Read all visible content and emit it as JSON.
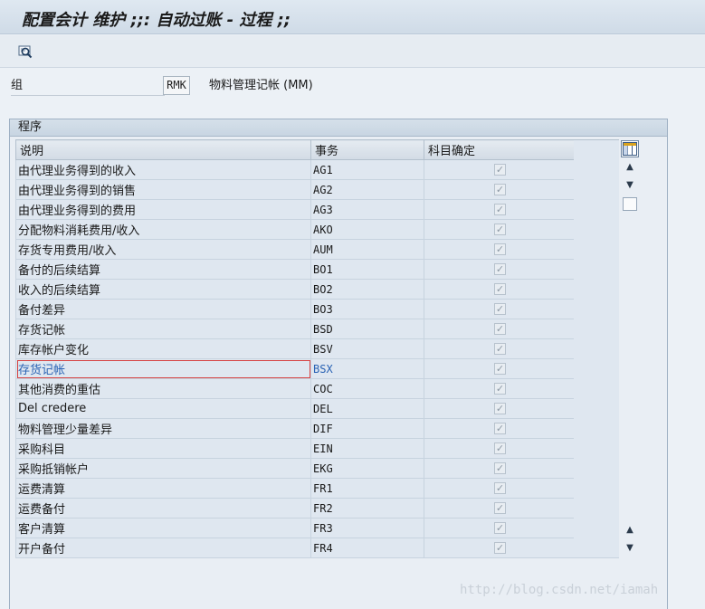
{
  "title": "配置会计 维护 ;;: 自动过账 - 过程 ;;",
  "toolbar": {
    "icon": "find-icon"
  },
  "header_field": {
    "label": "组",
    "value": "RMK",
    "description": "物料管理记帐 (MM)"
  },
  "group": {
    "title": "程序"
  },
  "table": {
    "columns": [
      "说明",
      "事务",
      "科目确定"
    ],
    "selected_index": 10,
    "rows": [
      {
        "desc": "由代理业务得到的收入",
        "code": "AG1",
        "checked": true
      },
      {
        "desc": "由代理业务得到的销售",
        "code": "AG2",
        "checked": true
      },
      {
        "desc": "由代理业务得到的费用",
        "code": "AG3",
        "checked": true
      },
      {
        "desc": "分配物料消耗费用/收入",
        "code": "AKO",
        "checked": true
      },
      {
        "desc": "存货专用费用/收入",
        "code": "AUM",
        "checked": true
      },
      {
        "desc": "备付的后续结算",
        "code": "BO1",
        "checked": true
      },
      {
        "desc": "收入的后续结算",
        "code": "BO2",
        "checked": true
      },
      {
        "desc": "备付差异",
        "code": "BO3",
        "checked": true
      },
      {
        "desc": "存货记帐",
        "code": "BSD",
        "checked": true
      },
      {
        "desc": "库存帐户变化",
        "code": "BSV",
        "checked": true
      },
      {
        "desc": "存货记帐",
        "code": "BSX",
        "checked": true
      },
      {
        "desc": "其他消费的重估",
        "code": "COC",
        "checked": true
      },
      {
        "desc": "Del credere",
        "code": "DEL",
        "checked": true
      },
      {
        "desc": "物料管理少量差异",
        "code": "DIF",
        "checked": true
      },
      {
        "desc": "采购科目",
        "code": "EIN",
        "checked": true
      },
      {
        "desc": "采购抵销帐户",
        "code": "EKG",
        "checked": true
      },
      {
        "desc": "运费清算",
        "code": "FR1",
        "checked": true
      },
      {
        "desc": "运费备付",
        "code": "FR2",
        "checked": true
      },
      {
        "desc": "客户清算",
        "code": "FR3",
        "checked": true
      },
      {
        "desc": "开户备付",
        "code": "FR4",
        "checked": true
      }
    ]
  },
  "watermark": "http://blog.csdn.net/iamah"
}
